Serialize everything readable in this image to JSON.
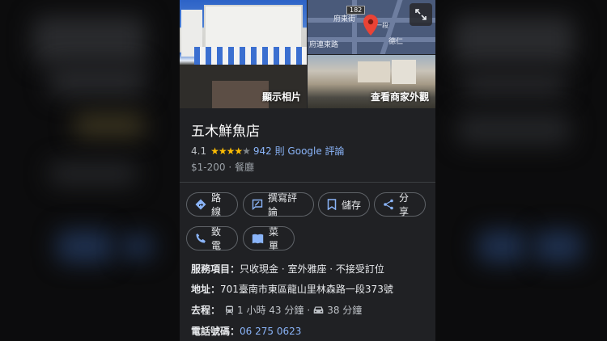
{
  "photos": {
    "main_caption": "顯示相片",
    "street_caption": "查看商家外觀",
    "map_labels": {
      "route_number": "182",
      "street_1": "府東街",
      "street_2": "府連東路",
      "street_3": "一段",
      "street_4": "德仁"
    }
  },
  "place": {
    "name": "五木鮮魚店",
    "rating": "4.1",
    "rating_value": 4.1,
    "reviews": "942 則 Google 評論",
    "price_category": "$1-200 · 餐廳"
  },
  "actions": {
    "route": "路線",
    "review": "撰寫評論",
    "save": "儲存",
    "share": "分享",
    "call": "致電",
    "menu": "菜單"
  },
  "info": {
    "services_label": "服務項目：",
    "services_value": "只收現金 · 室外雅座 · 不接受訂位",
    "address_label": "地址：",
    "address_value": "701臺南市東區龍山里林森路一段373號",
    "travel_label": "去程：",
    "transit_time": "1 小時 43 分鐘",
    "separator": "·",
    "drive_time": "38 分鐘",
    "phone_label": "電話號碼：",
    "phone_value": "06 275 0623"
  },
  "colors": {
    "panel_bg": "#202124",
    "link": "#8ab4f8",
    "star": "#fbbc04",
    "chip_icon": "#8ab4f8"
  }
}
